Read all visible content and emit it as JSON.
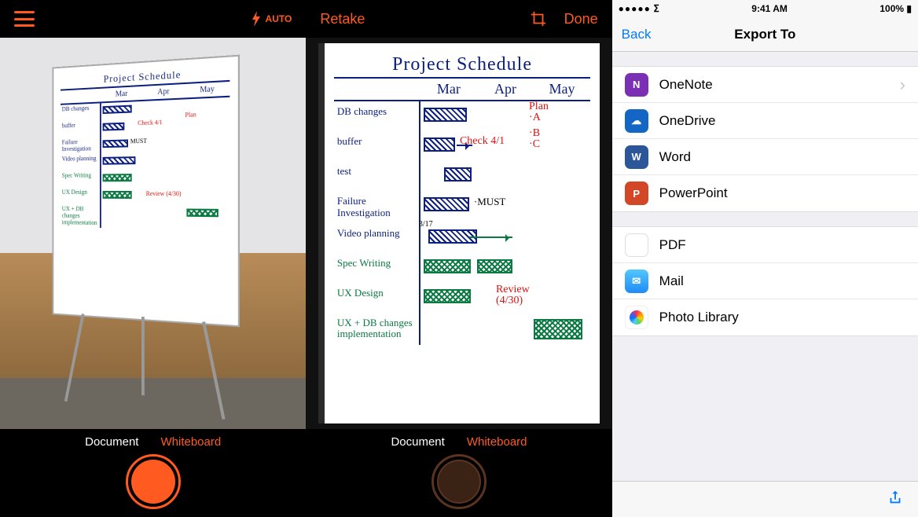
{
  "panel1": {
    "flash_mode": "AUTO",
    "modes": {
      "document": "Document",
      "whiteboard": "Whiteboard",
      "active": "whiteboard"
    }
  },
  "panel2": {
    "retake": "Retake",
    "done": "Done",
    "modes": {
      "document": "Document",
      "whiteboard": "Whiteboard",
      "active": "whiteboard"
    }
  },
  "whiteboard": {
    "title": "Project Schedule",
    "months": [
      "Mar",
      "Apr",
      "May"
    ],
    "rows": [
      "DB changes",
      "buffer",
      "test",
      "Failure Investigation",
      "Video planning",
      "Spec Writing",
      "UX Design",
      "UX + DB changes implementation"
    ],
    "notes": {
      "check": "Check 4/1",
      "plan": "Plan",
      "plan_items": [
        "A",
        "B",
        "C"
      ],
      "must": "MUST",
      "date_small": "3/17",
      "review": "Review (4/30)"
    }
  },
  "panel3": {
    "status": {
      "time": "9:41 AM",
      "battery": "100%"
    },
    "nav": {
      "back": "Back",
      "title": "Export To"
    },
    "group1": [
      {
        "key": "onenote",
        "label": "OneNote",
        "chevron": true
      },
      {
        "key": "onedrive",
        "label": "OneDrive"
      },
      {
        "key": "word",
        "label": "Word"
      },
      {
        "key": "powerpoint",
        "label": "PowerPoint"
      }
    ],
    "group2": [
      {
        "key": "pdf",
        "label": "PDF"
      },
      {
        "key": "mail",
        "label": "Mail"
      },
      {
        "key": "photos",
        "label": "Photo Library"
      }
    ]
  }
}
